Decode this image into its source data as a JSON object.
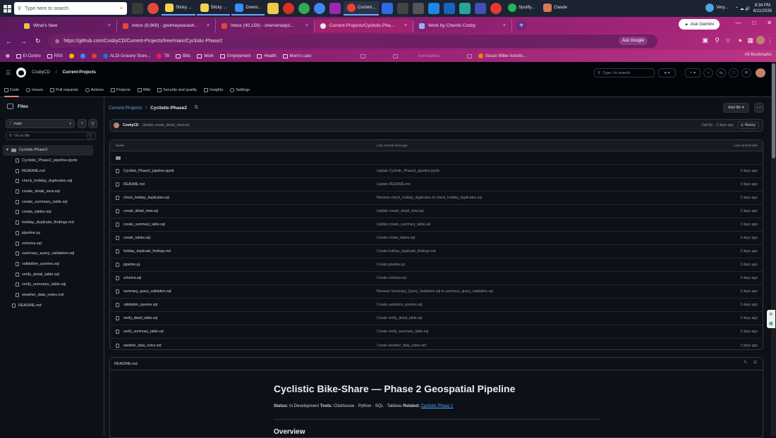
{
  "taskbar": {
    "search_placeholder": "Type here to search",
    "apps": [
      "Sticky ...",
      "Sticky ...",
      "Downl...",
      "Current...",
      "Spotify...",
      "Claude",
      "Very..."
    ],
    "clock_time": "8:34 PM",
    "clock_date": "6/11/2026"
  },
  "browser": {
    "tabs": [
      {
        "title": "What's New",
        "color": "#e8c14a"
      },
      {
        "title": "Inbox (8,968) - gretmeyedcash...",
        "color": "#ea4335"
      },
      {
        "title": "Inbox (40,159) - cherrieradyd...",
        "color": "#ea4335"
      },
      {
        "title": "Current-Projects/Cyclistic-Pha...",
        "color": "#e6edf3"
      },
      {
        "title": "Work by Cherrie Cosby",
        "color": "#8ab4f8"
      }
    ],
    "ask_gemini": "Ask Gemini",
    "url": "https://github.com/CosbyCD/Current-Projects/tree/main/Cyclistic-Phase2",
    "ask_google": "Ask Google",
    "bookmarks": [
      "El Centro",
      "RSS",
      "",
      "",
      "",
      "ALDI Grocery Store...",
      "TB",
      "Bills",
      "Work",
      "Employment",
      "Health",
      "Mom's care",
      "",
      "",
      "",
      "",
      "Summaries",
      "",
      "",
      "",
      "",
      "Susan Miller Astrolo..."
    ],
    "all_bookmarks": "All Bookmarks"
  },
  "github": {
    "owner": "CosbyCD",
    "repo": "Current-Projects",
    "search_placeholder": "Type / to search",
    "tabs": [
      "Code",
      "Issues",
      "Pull requests",
      "Actions",
      "Projects",
      "Wiki",
      "Security and quality",
      "Insights",
      "Settings"
    ],
    "sidebar": {
      "title": "Files",
      "branch": "main",
      "goto_placeholder": "Go to file",
      "folder": "Cyclistic-Phase2",
      "children": [
        "Cyclistic_Phase2_pipeline.ipynb",
        "README.md",
        "check_holiday_duplicates.sql",
        "create_detail_view.sql",
        "create_summary_table.sql",
        "create_tables.sql",
        "holiday_duplicate_findings.md",
        "pipeline.py",
        "schema.sql",
        "summary_query_validation.sql",
        "validation_queries.sql",
        "verify_detail_table.sql",
        "verify_summary_table.sql",
        "weather_data_notes.md"
      ],
      "root_file": "README.md"
    },
    "breadcrumb": {
      "parent": "Current-Projects",
      "current": "Cyclistic-Phase2"
    },
    "add_file": "Add file",
    "commit": {
      "author": "CosbyCD",
      "message": "Update create_detail_view.sql",
      "meta": "7ab19c · 2 days ago",
      "history": "History"
    },
    "table_header": {
      "name": "Name",
      "message": "Last commit message",
      "date": "Last commit date"
    },
    "parent_dir": "..",
    "files": [
      {
        "name": "Cyclistic_Phase2_pipeline.ipynb",
        "message": "Update Cyclistic_Phase2_pipeline.ipynb",
        "date": "3 days ago"
      },
      {
        "name": "README.md",
        "message": "Update README.md",
        "date": "3 days ago"
      },
      {
        "name": "check_holiday_duplicates.sql",
        "message": "Rename check_holiday_duplicates to check_holiday_duplicates.sql",
        "date": "2 days ago"
      },
      {
        "name": "create_detail_view.sql",
        "message": "Update create_detail_view.sql",
        "date": "2 days ago"
      },
      {
        "name": "create_summary_table.sql",
        "message": "Update create_summary_table.sql",
        "date": "2 days ago"
      },
      {
        "name": "create_tables.sql",
        "message": "Create create_tables.sql",
        "date": "3 days ago"
      },
      {
        "name": "holiday_duplicate_findings.md",
        "message": "Create holiday_duplicate_findings.md",
        "date": "2 days ago"
      },
      {
        "name": "pipeline.py",
        "message": "Create pipeline.py",
        "date": "3 days ago"
      },
      {
        "name": "schema.sql",
        "message": "Create schema.sql",
        "date": "3 days ago"
      },
      {
        "name": "summary_query_validation.sql",
        "message": "Rename Summary_Query_Validation.sql to summary_query_validation.sql",
        "date": "2 days ago"
      },
      {
        "name": "validation_queries.sql",
        "message": "Create validation_queries.sql",
        "date": "3 days ago"
      },
      {
        "name": "verify_detail_table.sql",
        "message": "Create verify_detail_table.sql",
        "date": "3 days ago"
      },
      {
        "name": "verify_summary_table.sql",
        "message": "Create verify_summary_table.sql",
        "date": "3 days ago"
      },
      {
        "name": "weather_data_notes.md",
        "message": "Create weather_data_notes.md",
        "date": "3 days ago"
      }
    ],
    "readme": {
      "filename": "README.md",
      "title": "Cyclistic Bike-Share — Phase 2 Geospatial Pipeline",
      "status_label": "Status:",
      "status_text": "In Development",
      "tools_label": "Tools:",
      "tools_text": "Clickhouse · Python · SQL · Tableau",
      "related_label": "Related:",
      "related_link": "Cyclistic Phase 1",
      "overview": "Overview"
    }
  }
}
